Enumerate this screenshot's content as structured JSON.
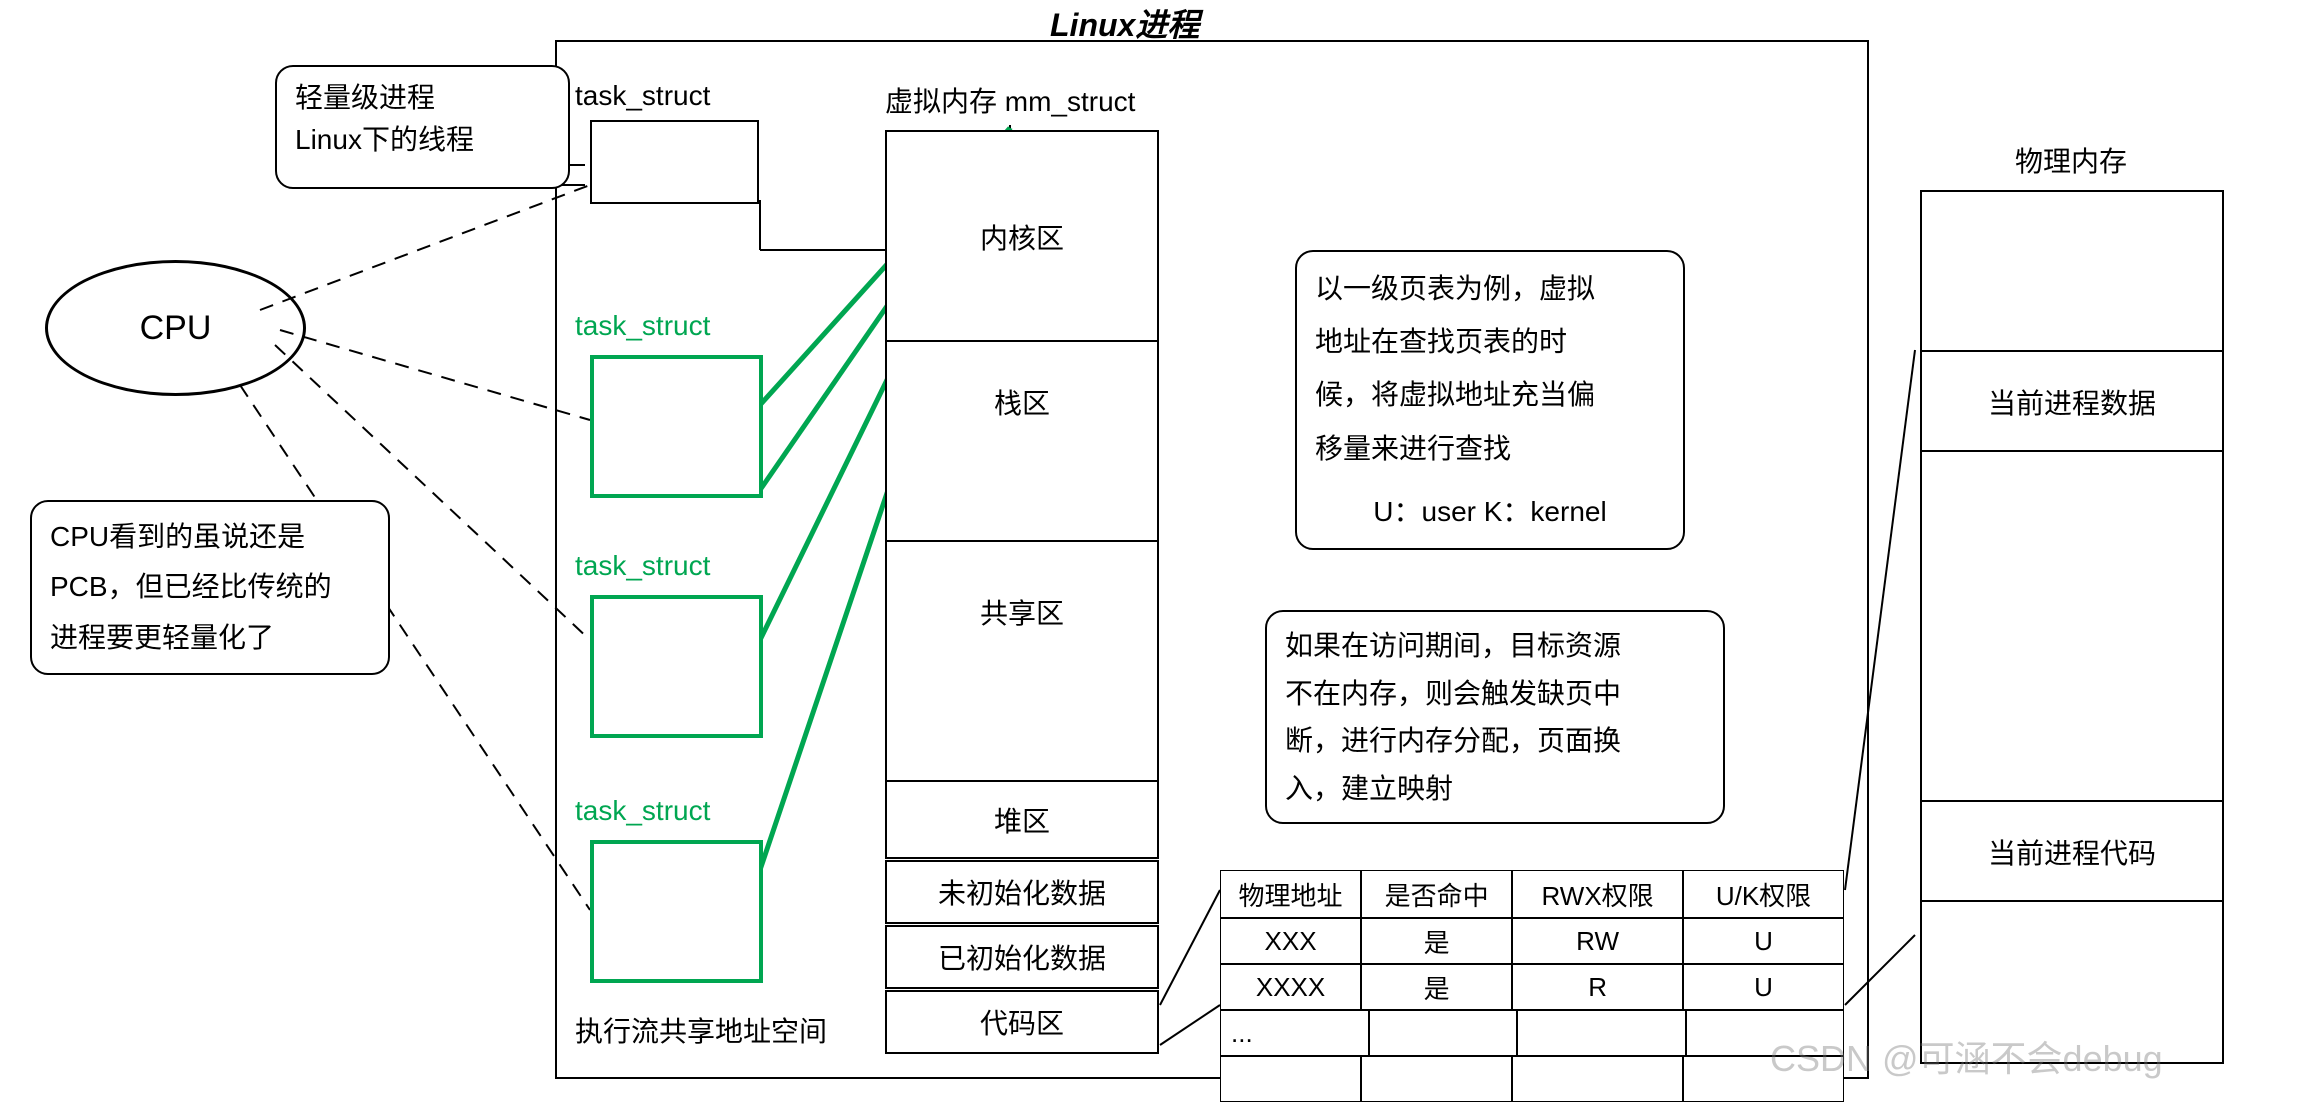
{
  "title": "Linux进程",
  "cpu": {
    "label": "CPU"
  },
  "bubble_lwp": {
    "line1": "轻量级进程",
    "line2": "Linux下的线程"
  },
  "bubble_cpu_note": {
    "line1": "CPU看到的虽说还是",
    "line2": "PCB，但已经比传统的",
    "line3": "进程要更轻量化了"
  },
  "task_struct_black": "task_struct",
  "task_structs_green": {
    "t1": "task_struct",
    "t2": "task_struct",
    "t3": "task_struct"
  },
  "exec_flow_label": "执行流共享地址空间",
  "mm_struct_label": "虚拟内存 mm_struct",
  "vm_segments": {
    "kernel": "内核区",
    "stack": "栈区",
    "shared": "共享区",
    "heap": "堆区",
    "bss": "未初始化数据",
    "data": "已初始化数据",
    "code": "代码区"
  },
  "note_pgtable": {
    "line1": "以一级页表为例，虚拟",
    "line2": "地址在查找页表的时",
    "line3": "候，将虚拟地址充当偏",
    "line4": "移量来进行查找",
    "line5": "U：user  K：kernel"
  },
  "note_pagefault": {
    "line1": "如果在访问期间，目标资源",
    "line2": "不在内存，则会触发缺页中",
    "line3": "断，进行内存分配，页面换",
    "line4": "入，建立映射"
  },
  "page_table": {
    "headers": {
      "c1": "物理地址",
      "c2": "是否命中",
      "c3": "RWX权限",
      "c4": "U/K权限"
    },
    "rows": [
      {
        "c1": "XXX",
        "c2": "是",
        "c3": "RW",
        "c4": "U"
      },
      {
        "c1": "XXXX",
        "c2": "是",
        "c3": "R",
        "c4": "U"
      },
      {
        "c1": "...",
        "c2": "",
        "c3": "",
        "c4": ""
      },
      {
        "c1": "",
        "c2": "",
        "c3": "",
        "c4": ""
      }
    ]
  },
  "phys_mem": {
    "title": "物理内存",
    "current_data": "当前进程数据",
    "current_code": "当前进程代码"
  },
  "watermark": "CSDN @可涵不会debug"
}
